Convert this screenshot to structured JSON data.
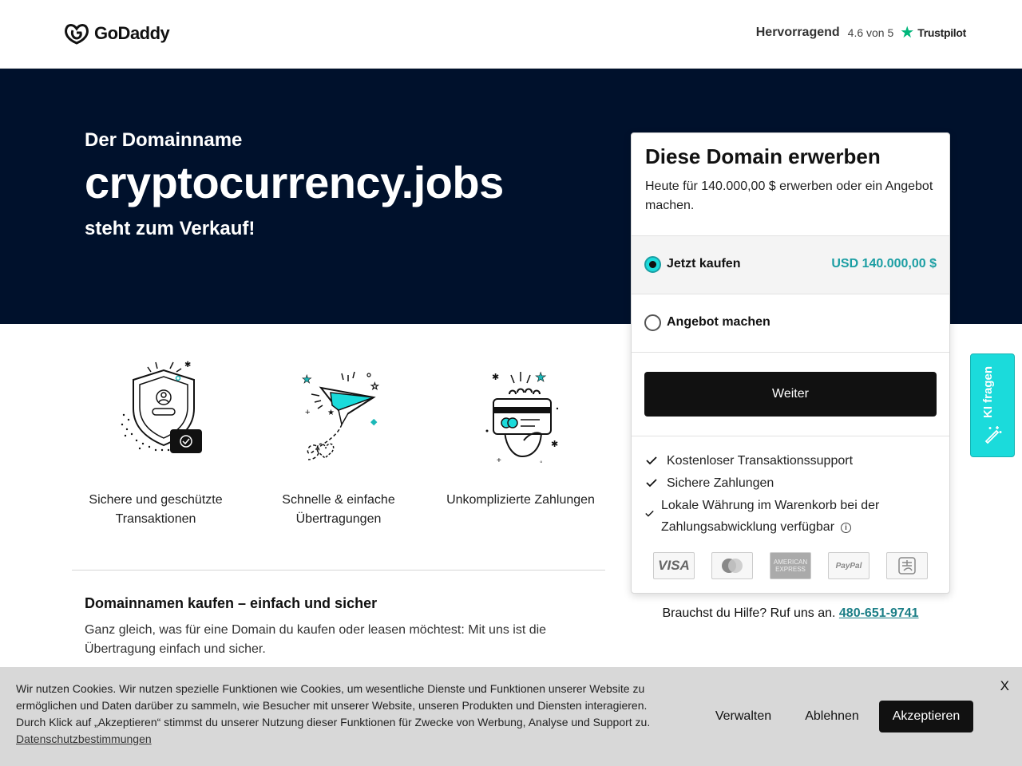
{
  "header": {
    "logo_text": "GoDaddy",
    "trustpilot": {
      "label": "Hervorragend",
      "score": "4.6 von 5",
      "brand": "Trustpilot",
      "star_color": "#00b67a"
    }
  },
  "hero": {
    "kicker": "Der Domainname",
    "domain": "cryptocurrency.jobs",
    "subtitle": "steht zum Verkauf!",
    "background": "#00112c"
  },
  "features": [
    {
      "icon": "shield-check-icon",
      "text": "Sichere und geschützte Transaktionen"
    },
    {
      "icon": "paper-plane-icon",
      "text": "Schnelle & einfache Übertragungen"
    },
    {
      "icon": "card-hand-icon",
      "text": "Unkomplizierte Zahlungen"
    }
  ],
  "info": {
    "title": "Domainnamen kaufen – einfach und sicher",
    "text": "Ganz gleich, was für eine Domain du kaufen oder leasen möchtest: Mit uns ist die Übertragung einfach und sicher."
  },
  "card": {
    "title": "Diese Domain erwerben",
    "description": "Heute für 140.000,00 $ erwerben oder ein Angebot machen.",
    "options": [
      {
        "label": "Jetzt kaufen",
        "price": "USD 140.000,00 $",
        "selected": true
      },
      {
        "label": "Angebot machen",
        "price": "",
        "selected": false
      }
    ],
    "cta": "Weiter",
    "bullets": [
      "Kostenloser Transaktionssupport",
      "Sichere Zahlungen",
      "Lokale Währung im Warenkorb bei der Zahlungsabwicklung verfügbar"
    ],
    "payment_methods": [
      "VISA",
      "mastercard-icon",
      "AMERICAN EXPRESS",
      "PayPal",
      "alipay-icon"
    ],
    "accent": "#1b9ea3"
  },
  "help": {
    "text": "Brauchst du Hilfe? Ruf uns an.",
    "phone": "480-651-9741"
  },
  "ki_button": {
    "label": "KI fragen",
    "color": "#1bdbdb"
  },
  "cookie": {
    "text": "Wir nutzen Cookies. Wir nutzen spezielle Funktionen wie Cookies, um wesentliche Dienste und Funktionen unserer Website zu ermöglichen und Daten darüber zu sammeln, wie Besucher mit unserer Website, unseren Produkten und Diensten interagieren. Durch Klick auf „Akzeptieren“ stimmst du unserer Nutzung dieser Funktionen für Zwecke von Werbung, Analyse und Support zu.",
    "link": "Datenschutzbestimmungen",
    "close": "X",
    "manage": "Verwalten",
    "decline": "Ablehnen",
    "accept": "Akzeptieren"
  }
}
